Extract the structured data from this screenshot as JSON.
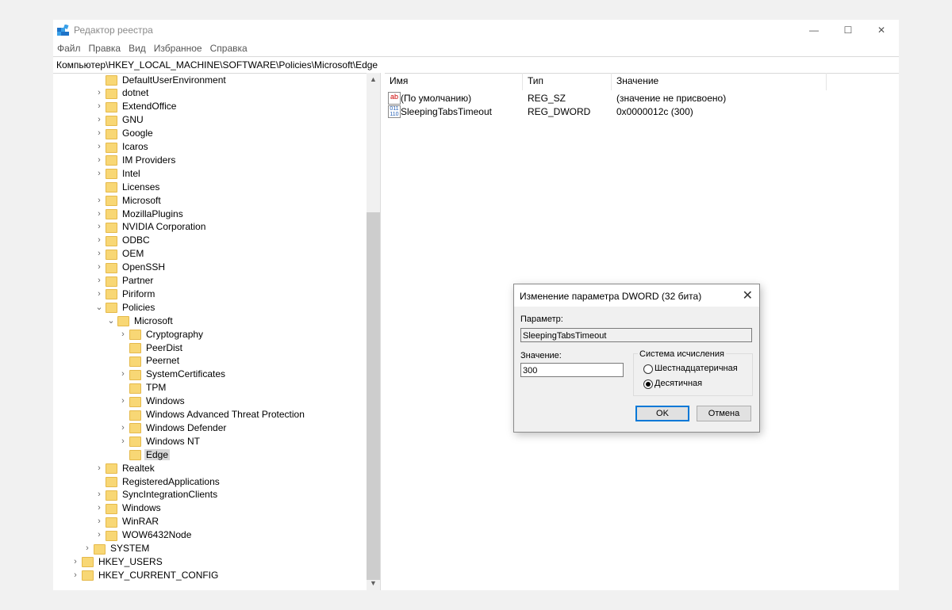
{
  "window": {
    "title": "Редактор реестра",
    "controls": {
      "minimize": "—",
      "maximize": "☐",
      "close": "✕"
    }
  },
  "menu": [
    "Файл",
    "Правка",
    "Вид",
    "Избранное",
    "Справка"
  ],
  "address": "Компьютер\\HKEY_LOCAL_MACHINE\\SOFTWARE\\Policies\\Microsoft\\Edge",
  "tree": [
    {
      "label": "DefaultUserEnvironment",
      "level": 2,
      "expander": ""
    },
    {
      "label": "dotnet",
      "level": 2,
      "expander": ">"
    },
    {
      "label": "ExtendOffice",
      "level": 2,
      "expander": ">"
    },
    {
      "label": "GNU",
      "level": 2,
      "expander": ">"
    },
    {
      "label": "Google",
      "level": 2,
      "expander": ">"
    },
    {
      "label": "Icaros",
      "level": 2,
      "expander": ">"
    },
    {
      "label": "IM Providers",
      "level": 2,
      "expander": ">"
    },
    {
      "label": "Intel",
      "level": 2,
      "expander": ">"
    },
    {
      "label": "Licenses",
      "level": 2,
      "expander": ""
    },
    {
      "label": "Microsoft",
      "level": 2,
      "expander": ">"
    },
    {
      "label": "MozillaPlugins",
      "level": 2,
      "expander": ">"
    },
    {
      "label": "NVIDIA Corporation",
      "level": 2,
      "expander": ">"
    },
    {
      "label": "ODBC",
      "level": 2,
      "expander": ">"
    },
    {
      "label": "OEM",
      "level": 2,
      "expander": ">"
    },
    {
      "label": "OpenSSH",
      "level": 2,
      "expander": ">"
    },
    {
      "label": "Partner",
      "level": 2,
      "expander": ">"
    },
    {
      "label": "Piriform",
      "level": 2,
      "expander": ">"
    },
    {
      "label": "Policies",
      "level": 2,
      "expander": "v"
    },
    {
      "label": "Microsoft",
      "level": 3,
      "expander": "v"
    },
    {
      "label": "Cryptography",
      "level": 4,
      "expander": ">"
    },
    {
      "label": "PeerDist",
      "level": 4,
      "expander": ""
    },
    {
      "label": "Peernet",
      "level": 4,
      "expander": ""
    },
    {
      "label": "SystemCertificates",
      "level": 4,
      "expander": ">"
    },
    {
      "label": "TPM",
      "level": 4,
      "expander": ""
    },
    {
      "label": "Windows",
      "level": 4,
      "expander": ">"
    },
    {
      "label": "Windows Advanced Threat Protection",
      "level": 4,
      "expander": ""
    },
    {
      "label": "Windows Defender",
      "level": 4,
      "expander": ">"
    },
    {
      "label": "Windows NT",
      "level": 4,
      "expander": ">"
    },
    {
      "label": "Edge",
      "level": 4,
      "expander": "",
      "selected": true
    },
    {
      "label": "Realtek",
      "level": 2,
      "expander": ">"
    },
    {
      "label": "RegisteredApplications",
      "level": 2,
      "expander": ""
    },
    {
      "label": "SyncIntegrationClients",
      "level": 2,
      "expander": ">"
    },
    {
      "label": "Windows",
      "level": 2,
      "expander": ">"
    },
    {
      "label": "WinRAR",
      "level": 2,
      "expander": ">"
    },
    {
      "label": "WOW6432Node",
      "level": 2,
      "expander": ">"
    },
    {
      "label": "SYSTEM",
      "level": 1,
      "expander": ">"
    },
    {
      "label": "HKEY_USERS",
      "level": 0,
      "expander": ">"
    },
    {
      "label": "HKEY_CURRENT_CONFIG",
      "level": 0,
      "expander": ">"
    }
  ],
  "values_pane": {
    "columns": [
      "Имя",
      "Тип",
      "Значение"
    ],
    "rows": [
      {
        "icon": "string-value-icon",
        "name": "(По умолчанию)",
        "type": "REG_SZ",
        "data": "(значение не присвоено)"
      },
      {
        "icon": "dword-value-icon",
        "name": "SleepingTabsTimeout",
        "type": "REG_DWORD",
        "data": "0x0000012c (300)"
      }
    ]
  },
  "dialog": {
    "title": "Изменение параметра DWORD (32 бита)",
    "param_label": "Параметр:",
    "param_value": "SleepingTabsTimeout",
    "value_label": "Значение:",
    "value": "300",
    "base_group": "Система исчисления",
    "radio_hex": "Шестнадцатеричная",
    "radio_dec": "Десятичная",
    "selected_base": "dec",
    "ok": "OK",
    "cancel": "Отмена"
  },
  "colors": {
    "folder": "#f8d775",
    "accent": "#0078d7",
    "selection": "#d9d9d9"
  }
}
